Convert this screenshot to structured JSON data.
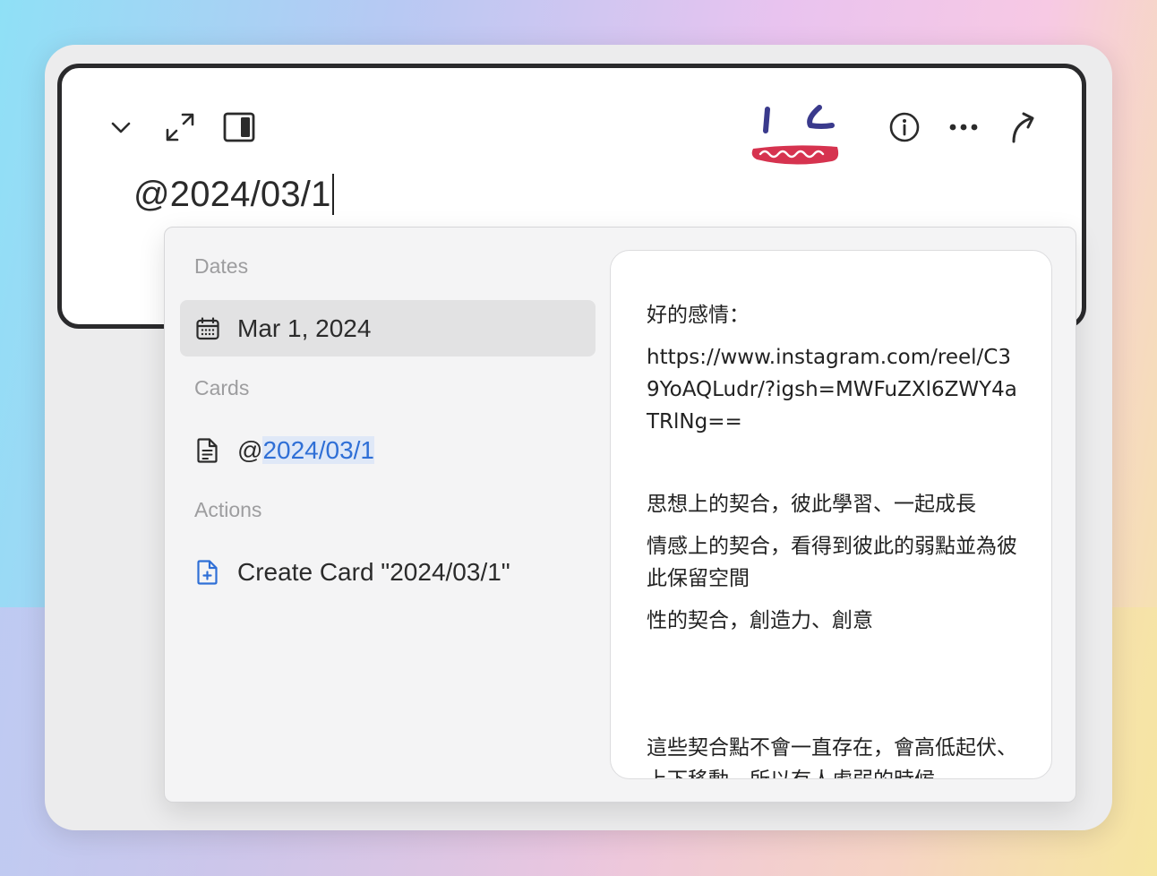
{
  "editor": {
    "title_value": "@2024/03/1",
    "toolbar": {
      "collapse_icon": "chevron-down-icon",
      "expand_icon": "expand-arrows-icon",
      "panel_icon": "side-panel-icon",
      "info_icon": "info-icon",
      "more_icon": "ellipsis-icon",
      "share_icon": "share-arrow-icon"
    },
    "avatar": "face-doodle-icon"
  },
  "popup": {
    "sections": {
      "dates": "Dates",
      "cards": "Cards",
      "actions": "Actions"
    },
    "date_option": {
      "label": "Mar 1, 2024",
      "icon": "calendar-icon"
    },
    "card_option": {
      "prefix": "@",
      "match": "2024/03/1",
      "icon": "document-icon"
    },
    "action_option": {
      "label": "Create Card \"2024/03/1\"",
      "icon": "new-document-icon"
    }
  },
  "preview": {
    "heading": "好的感情：",
    "link": "https://www.instagram.com/reel/C39YoAQLudr/?igsh=MWFuZXl6ZWY4aTRlNg==",
    "line1": "思想上的契合，彼此學習、一起成長",
    "line2": "情感上的契合，看得到彼此的弱點並為彼此保留空間",
    "line3": "性的契合，創造力、創意",
    "line4": "這些契合點不會一直存在，會高低起伏、上下移動，所以有人虛弱的時候，"
  },
  "colors": {
    "accent": "#2f6fd6",
    "selected_bg": "#e2e2e3",
    "avatar_stroke": "#3a3a8c",
    "avatar_mouth": "#d6334f"
  }
}
